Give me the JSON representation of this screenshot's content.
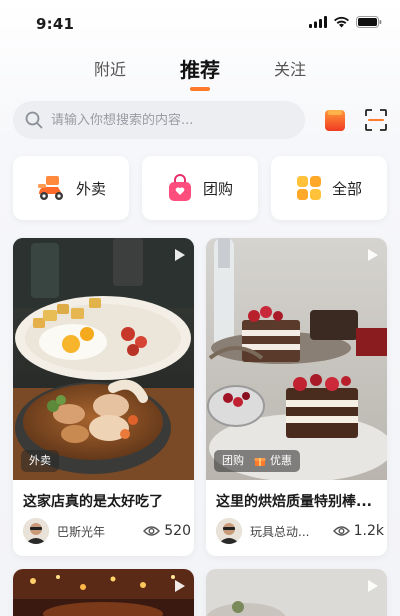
{
  "status": {
    "time": "9:41"
  },
  "tabs": [
    {
      "label": "附近",
      "active": false
    },
    {
      "label": "推荐",
      "active": true
    },
    {
      "label": "关注",
      "active": false
    }
  ],
  "search": {
    "placeholder": "请输入你想搜索的内容..."
  },
  "categories": [
    {
      "label": "外卖",
      "icon": "delivery-scooter-icon"
    },
    {
      "label": "团购",
      "icon": "shopping-bag-icon"
    },
    {
      "label": "全部",
      "icon": "grid-icon"
    }
  ],
  "posts": [
    {
      "tag": "外卖",
      "title": "这家店真的是太好吃了",
      "author": "巴斯光年",
      "views": "520"
    },
    {
      "tag": "团购",
      "tag_extra": "优惠",
      "title": "这里的烘焙质量特别棒...",
      "author": "玩具总动...",
      "views": "1.2k"
    }
  ],
  "colors": {
    "accent": "#ff7a2a",
    "tab_active": "#111111",
    "search_bg": "#eceef2"
  }
}
